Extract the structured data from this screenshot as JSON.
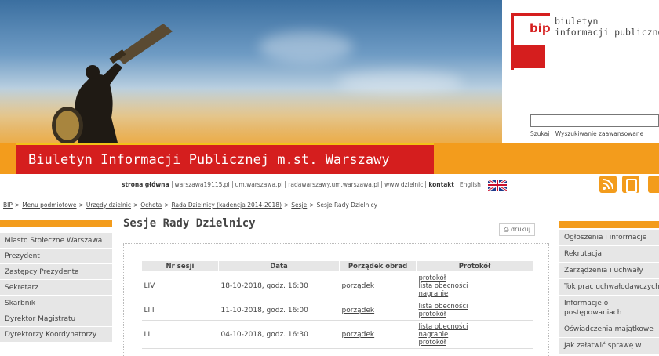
{
  "header": {
    "bip_logo_text": "bip",
    "bip_line1": "biuletyn",
    "bip_line2": "informacji publicznej",
    "search_placeholder": "",
    "search_links": [
      "Szukaj",
      "Wyszukiwanie zaawansowane"
    ],
    "site_title": "Biuletyn Informacji Publicznej m.st. Warszawy"
  },
  "toplinks": [
    {
      "label": "strona główna",
      "bold": true
    },
    {
      "label": "warszawa19115.pl",
      "bold": false
    },
    {
      "label": "um.warszawa.pl",
      "bold": false
    },
    {
      "label": "radawarszawy.um.warszawa.pl",
      "bold": false
    },
    {
      "label": "www dzielnic",
      "bold": false
    },
    {
      "label": "kontakt",
      "bold": true
    },
    {
      "label": "English",
      "bold": false
    }
  ],
  "icons": {
    "rss": "rss-icon",
    "info": "info-icon",
    "phone": "mobile-icon"
  },
  "breadcrumb": [
    "BIP",
    "Menu podmiotowe",
    "Urzędy dzielnic",
    "Ochota",
    "Rada Dzielnicy (kadencja 2014-2018)",
    "Sesje",
    "Sesje Rady Dzielnicy"
  ],
  "left_nav": [
    "Miasto Stołeczne Warszawa",
    "Prezydent",
    "Zastępcy Prezydenta",
    "Sekretarz",
    "Skarbnik",
    "Dyrektor Magistratu",
    "Dyrektorzy Koordynatorzy"
  ],
  "right_nav": [
    "Ogłoszenia i informacje",
    "Rekrutacja",
    "Zarządzenia i uchwały",
    "Tok prac uchwałodawczych",
    "Informacje o postępowaniach",
    "Oświadczenia majątkowe",
    "Jak załatwić sprawę w"
  ],
  "main": {
    "title": "Sesje Rady Dzielnicy",
    "print_label": "drukuj",
    "table_headers": [
      "Nr sesji",
      "Data",
      "Porządek obrad",
      "Protokół"
    ],
    "rows": [
      {
        "nr": "LIV",
        "date": "18-10-2018, godz. 16:30",
        "order": "porządek",
        "protocol": [
          "protokół",
          "lista obecności",
          "nagranie"
        ]
      },
      {
        "nr": "LIII",
        "date": "11-10-2018, godz. 16:00",
        "order": "porządek",
        "protocol": [
          "lista obecności",
          "protokół"
        ]
      },
      {
        "nr": "LII",
        "date": "04-10-2018, godz. 16:30",
        "order": "porządek",
        "protocol": [
          "lista obecności",
          "nagranie",
          "protokół"
        ]
      }
    ]
  },
  "colors": {
    "orange": "#f39c1c",
    "red": "#d51e1e",
    "yellow": "#f2c218",
    "sidebar_gray": "#e6e6e6"
  }
}
